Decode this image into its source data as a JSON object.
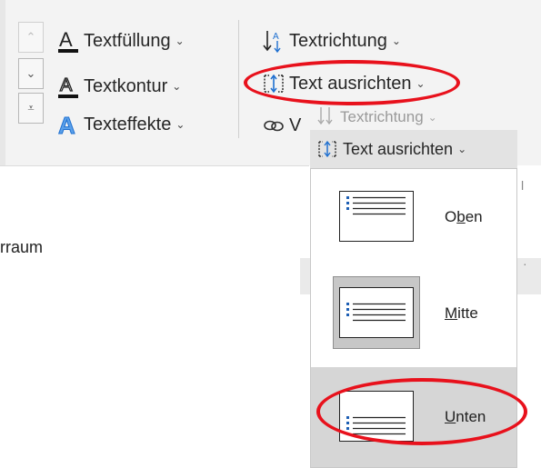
{
  "ribbon": {
    "left_commands": [
      {
        "label": "Textfüllung",
        "icon": "text-fill-icon"
      },
      {
        "label": "Textkontur",
        "icon": "text-outline-icon"
      },
      {
        "label": "Texteffekte",
        "icon": "text-effects-icon"
      }
    ],
    "scroll_buttons": [
      {
        "glyph": "⌃",
        "name": "scroll-up-button"
      },
      {
        "glyph": "⌄",
        "name": "scroll-down-button"
      },
      {
        "glyph": "⩡",
        "name": "more-styles-button"
      }
    ],
    "right_commands": {
      "text_direction": "Textrichtung",
      "text_align": "Text ausrichten",
      "link_partial": "V"
    },
    "ghost_text_direction": "Textrichtung"
  },
  "flyout": {
    "button_label": "Text ausrichten",
    "items": [
      {
        "label_pre": "O",
        "label_key": "b",
        "label_post": "en",
        "state": "normal",
        "lines_position": "top"
      },
      {
        "label_pre": "",
        "label_key": "M",
        "label_post": "itte",
        "state": "pressed",
        "lines_position": "middle"
      },
      {
        "label_pre": "",
        "label_key": "U",
        "label_post": "nten",
        "state": "hover",
        "lines_position": "bottom"
      }
    ]
  },
  "document": {
    "partial_text": "rraum"
  },
  "highlight_color": "#e8111c",
  "accent_color": "#1e6fd0"
}
